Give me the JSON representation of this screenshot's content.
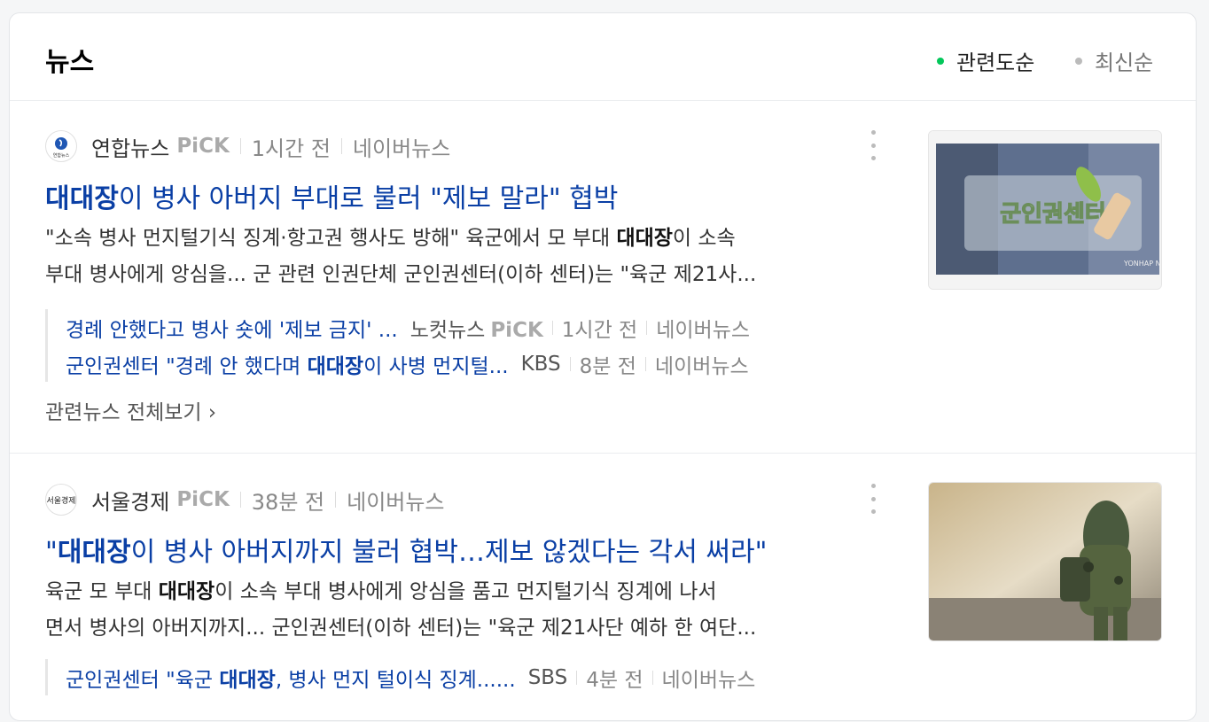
{
  "header": {
    "title": "뉴스",
    "sort_options": [
      {
        "label": "관련도순",
        "active": true
      },
      {
        "label": "최신순",
        "active": false
      }
    ]
  },
  "articles": [
    {
      "press": "연합뉴스",
      "logo_text": "연합뉴스",
      "pick": "PiCK",
      "time": "1시간 전",
      "portal": "네이버뉴스",
      "headline_bold": "대대장",
      "headline_rest": "이 병사 아버지 부대로 불러 \"제보 말라\" 협박",
      "desc_line1_a": "\"소속 병사 먼지털기식 징계·항고권 행사도 방해\" 육군에서 모 부대 ",
      "desc_line1_b": "대대장",
      "desc_line1_c": "이 소속",
      "desc_line2": "부대 병사에게 앙심을... 군 관련 인권단체 군인권센터(이하 센터)는 \"육군 제21사...",
      "thumb_caption": "YONHAP NEWS",
      "thumb_sign": "군인권센터",
      "related": [
        {
          "title_a": "경례 안했다고 병사 숏에 '제보 금지' ...",
          "title_b": "",
          "title_c": "",
          "press": "노컷뉴스",
          "pick": "PiCK",
          "time": "1시간 전",
          "portal": "네이버뉴스"
        },
        {
          "title_a": "군인권센터 \"경례 안 했다며 ",
          "title_b": "대대장",
          "title_c": "이 사병 먼지털...",
          "press": "KBS",
          "pick": "",
          "time": "8분 전",
          "portal": "네이버뉴스"
        }
      ],
      "all_link": "관련뉴스 전체보기 ›"
    },
    {
      "press": "서울경제",
      "logo_text": "서울경제",
      "pick": "PiCK",
      "time": "38분 전",
      "portal": "네이버뉴스",
      "headline_pre": "\"",
      "headline_bold": "대대장",
      "headline_rest": "이 병사 아버지까지 불러 협박…제보 않겠다는 각서 써라\"",
      "desc_line1_a": "육군 모 부대 ",
      "desc_line1_b": "대대장",
      "desc_line1_c": "이 소속 부대 병사에게 앙심을 품고 먼지털기식 징계에 나서",
      "desc_line2": "면서 병사의 아버지까지... 군인권센터(이하 센터)는 \"육군 제21사단 예하 한 여단...",
      "related": [
        {
          "title_a": "군인권센터 \"육군 ",
          "title_b": "대대장",
          "title_c": ", 병사 먼지 털이식 징계......",
          "press": "SBS",
          "time": "4분 전",
          "portal": "네이버뉴스"
        }
      ]
    }
  ],
  "colors": {
    "link_blue": "#0a3fa5",
    "active_dot": "#03c75a",
    "inactive_dot": "#bbbbbb"
  }
}
